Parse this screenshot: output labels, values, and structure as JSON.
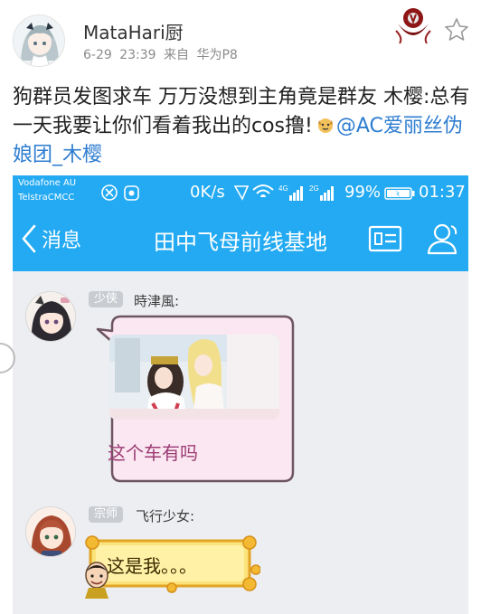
{
  "post": {
    "author": "MataHari厨",
    "time": "6-29 23:39",
    "source": "来自 华为P8",
    "text_main": "狗群员发图求车 万万没想到主角竟是群友 木樱:总有一天我要让你们看着我出的cos撸!",
    "mention": "@AC爱丽丝伪娘团_木樱"
  },
  "qq": {
    "status": {
      "carrier_1": "Vodafone AU",
      "carrier_2": "TelstraCMCC",
      "speed": "0K/s",
      "battery": "99%",
      "clock": "01:37"
    },
    "title_bar": {
      "back_label": "消息",
      "group_title": "田中飞母前线基地"
    },
    "messages": [
      {
        "rank": "少侠",
        "sender": "時津風:",
        "text": "这个车有吗"
      },
      {
        "rank": "宗师",
        "sender": "飞行少女:",
        "text": "这是我。。。"
      }
    ]
  },
  "colors": {
    "qq_blue": "#23aaf2",
    "mention_blue": "#2e7dd1",
    "pink_bubble_border": "#7a5a6a",
    "pink_bubble_fill": "#fbe7f1",
    "gold_bubble": "#f7c948",
    "pink_text": "#9b3b74"
  },
  "icons": [
    "follow-star-icon",
    "back-arrow-icon",
    "profile-card-icon",
    "group-members-icon",
    "wifi-icon",
    "signal-4g-icon",
    "signal-2g-icon",
    "battery-icon",
    "smiling-dog-emoji"
  ]
}
